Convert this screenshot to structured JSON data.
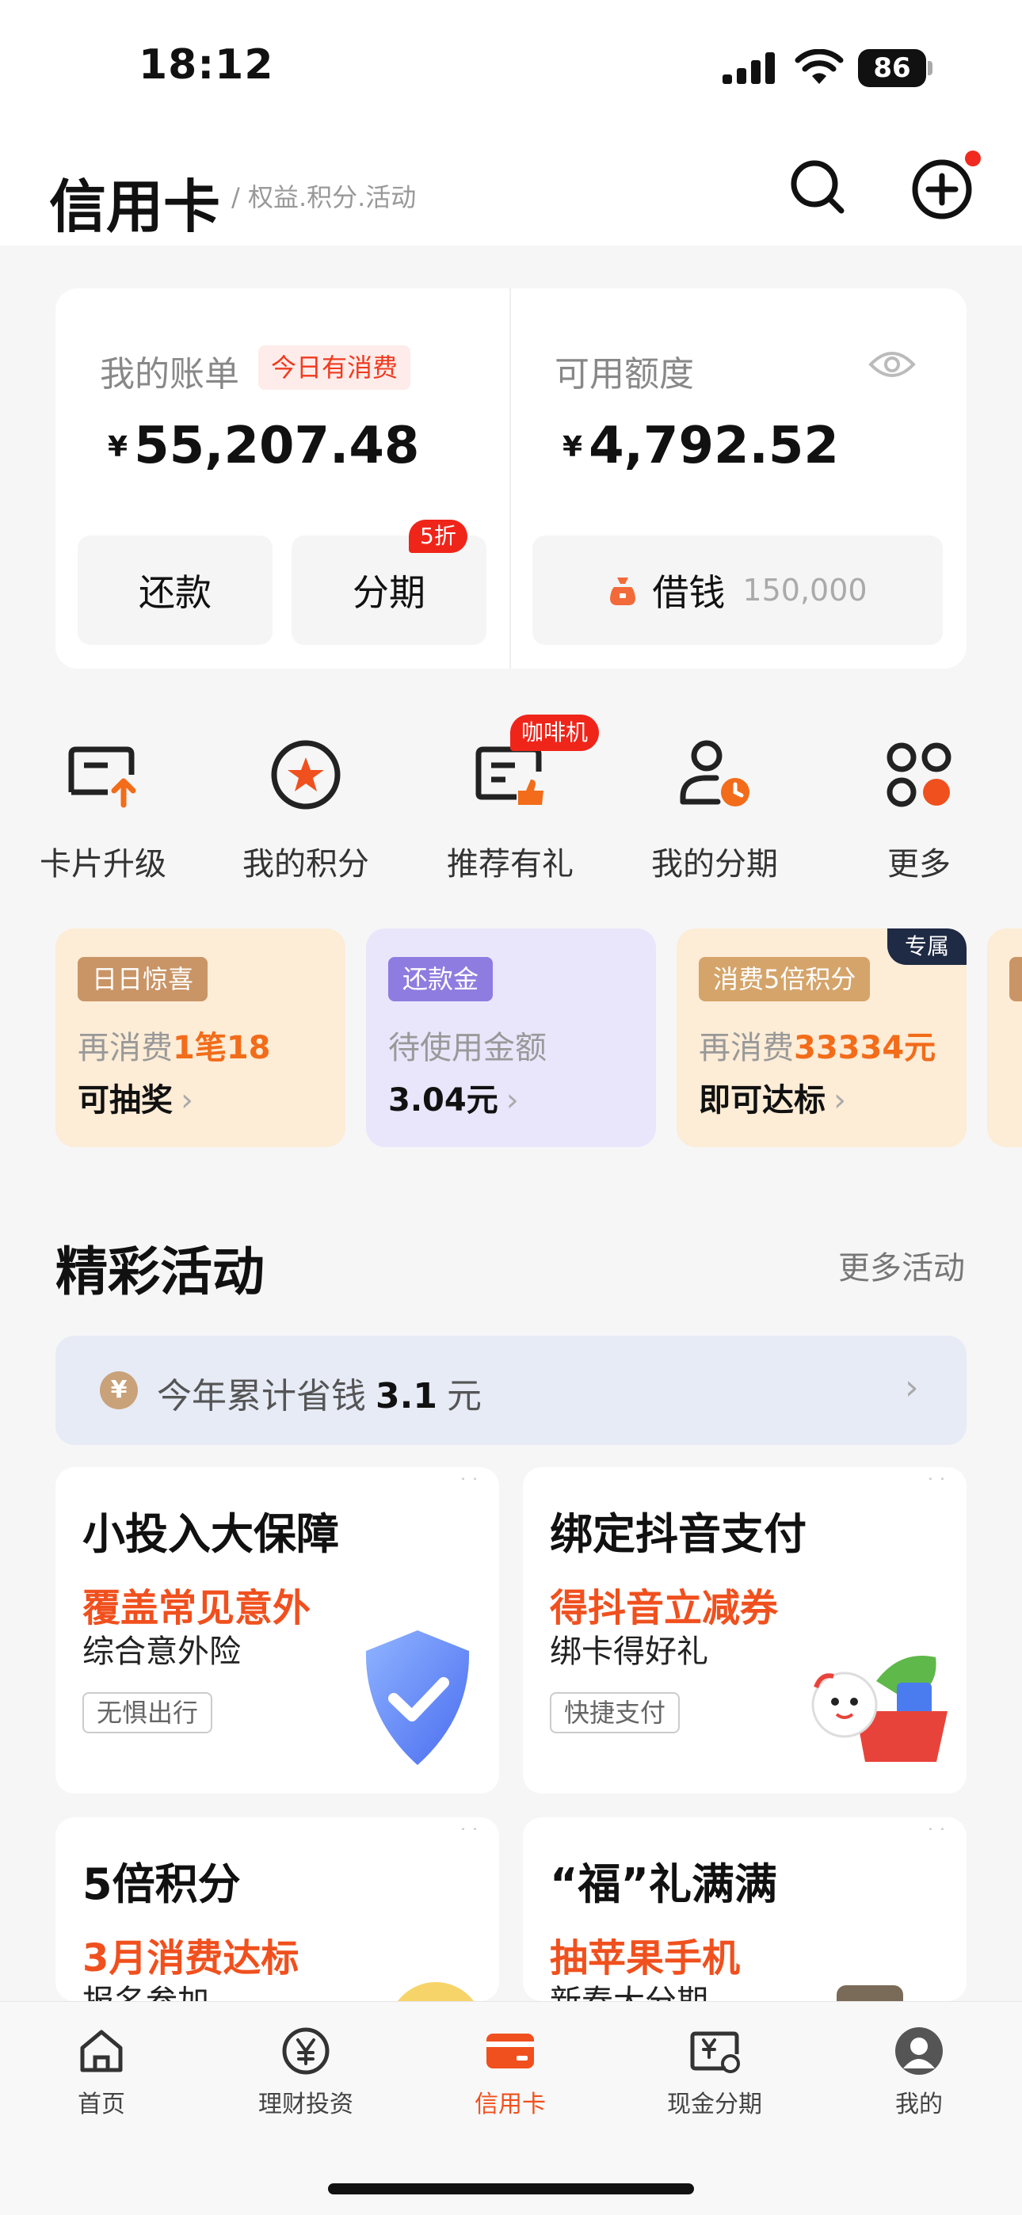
{
  "status": {
    "time": "18:12",
    "battery": "86"
  },
  "header": {
    "title": "信用卡",
    "subtitle": "/ 权益.积分.活动"
  },
  "bill": {
    "label": "我的账单",
    "today_tag": "今日有消费",
    "currency": "¥",
    "amount": "55,207.48",
    "repay": "还款",
    "installment": "分期",
    "discount": "5折"
  },
  "credit": {
    "label": "可用额度",
    "currency": "¥",
    "amount": "4,792.52",
    "borrow": "借钱",
    "borrow_amount": "150,000"
  },
  "quick_actions": [
    {
      "label": "卡片升级",
      "icon": "card-upgrade-icon"
    },
    {
      "label": "我的积分",
      "icon": "points-star-icon"
    },
    {
      "label": "推荐有礼",
      "icon": "referral-icon",
      "tag": "咖啡机"
    },
    {
      "label": "我的分期",
      "icon": "installment-user-icon"
    },
    {
      "label": "更多",
      "icon": "more-grid-icon"
    }
  ],
  "promos": [
    {
      "tag": "日日惊喜",
      "line2_pre": "再消费",
      "line2_hl": "1笔18",
      "line3": "可抽奖"
    },
    {
      "tag": "还款金",
      "line2_pre": "待使用金额",
      "line2_hl": "",
      "line3": "3.04元"
    },
    {
      "tag": "消费5倍积分",
      "line2_pre": "再消费",
      "line2_hl": "33334元",
      "line3": "即可达标",
      "corner": "专属"
    }
  ],
  "activities": {
    "title": "精彩活动",
    "more": "更多活动",
    "saved_pre": "今年累计省钱",
    "saved_value": "3.1",
    "saved_unit": "元",
    "cards": [
      {
        "title": "小投入大保障",
        "highlight": "覆盖常见意外",
        "desc": "综合意外险",
        "badge": "无惧出行"
      },
      {
        "title": "绑定抖音支付",
        "highlight": "得抖音立减券",
        "desc": "绑卡得好礼",
        "badge": "快捷支付"
      },
      {
        "title": "5倍积分",
        "highlight": "3月消费达标",
        "desc": "报名参加"
      },
      {
        "title": "“福”礼满满",
        "highlight": "抽苹果手机",
        "desc": "新春大分期"
      }
    ]
  },
  "tabs": [
    {
      "label": "首页"
    },
    {
      "label": "理财投资"
    },
    {
      "label": "信用卡"
    },
    {
      "label": "现金分期"
    },
    {
      "label": "我的"
    }
  ],
  "colors": {
    "accent": "#f0501e",
    "red": "#f0251a",
    "orange_hl": "#f26c1a"
  }
}
